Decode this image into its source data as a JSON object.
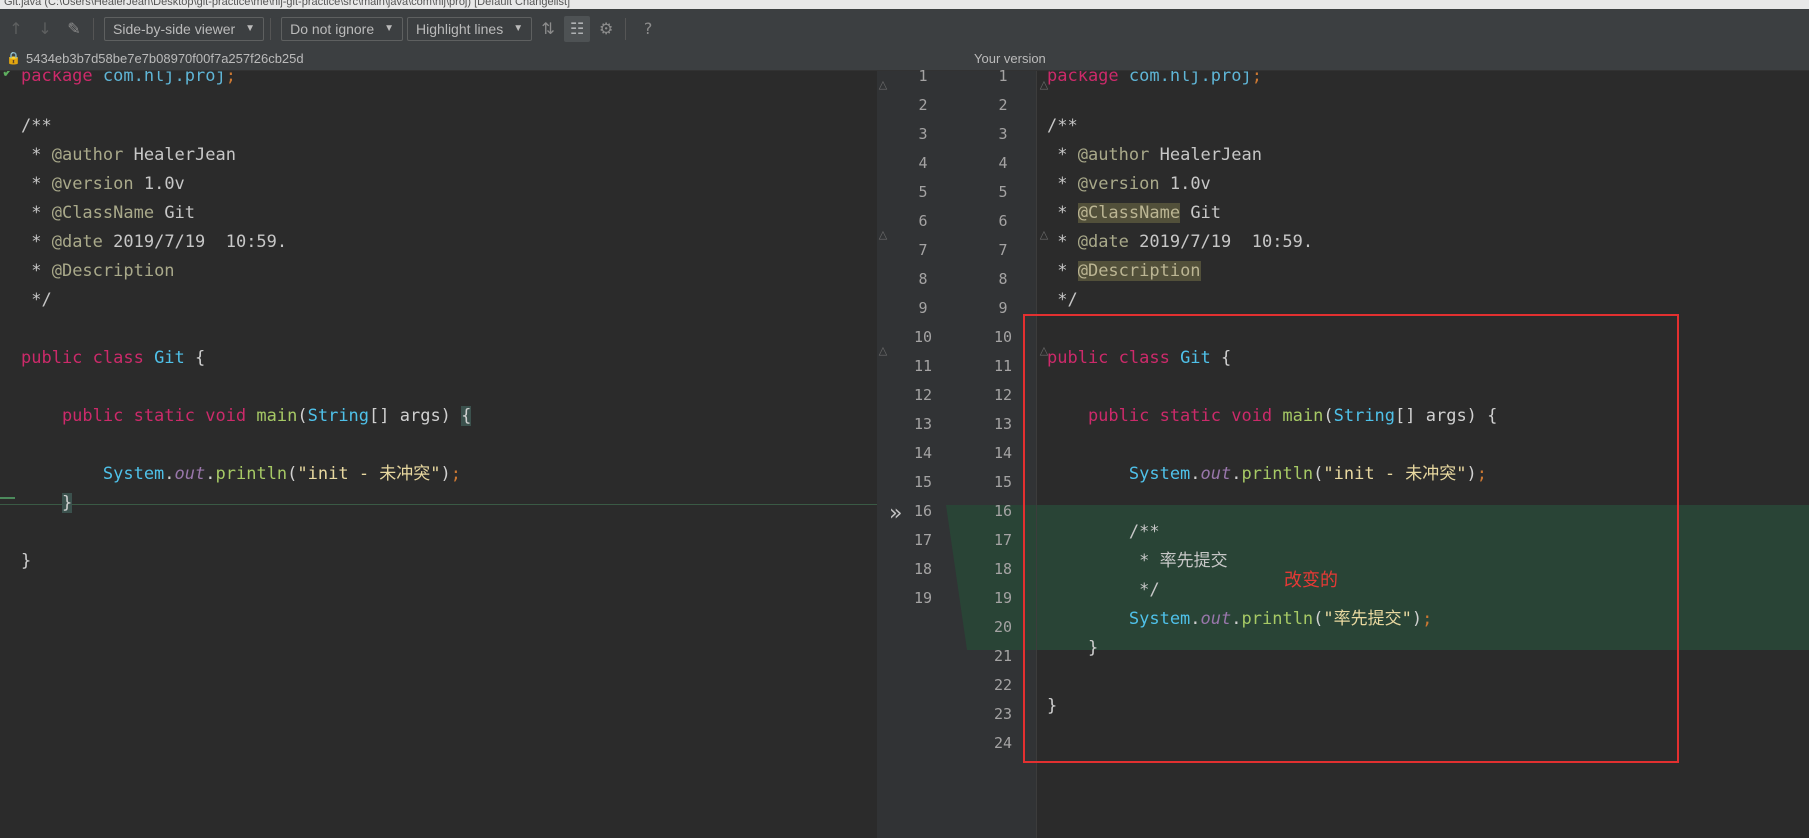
{
  "window_title": "Git.java (C:\\Users\\HealerJean\\Desktop\\git-practice\\me\\hlj-git-practice\\src\\main\\java\\com\\hlj\\proj) [Default Changelist]",
  "toolbar": {
    "viewer_mode": "Side-by-side viewer",
    "whitespace": "Do not ignore",
    "highlight": "Highlight lines",
    "help": "?"
  },
  "infobar": {
    "left_revision": "5434eb3b7d58be7e7b08970f00f7a257f26cb25d",
    "right_title": "Your version"
  },
  "left": {
    "line_numbers": [
      "1",
      "2",
      "3",
      "4",
      "5",
      "6",
      "7",
      "8",
      "9",
      "10",
      "11",
      "12",
      "13",
      "14",
      "15",
      "16",
      "17",
      "18",
      "19"
    ],
    "lines": [
      "package com.hlj.proj;",
      "",
      "/**",
      " * @author HealerJean",
      " * @version 1.0v",
      " * @ClassName Git",
      " * @date 2019/7/19  10:59.",
      " * @Description",
      " */",
      "",
      "public class Git {",
      "",
      "    public static void main(String[] args) {",
      "",
      "        System.out.println(\"init - 未冲突\");",
      "    }",
      "",
      "}",
      ""
    ]
  },
  "right": {
    "line_numbers": [
      "1",
      "2",
      "3",
      "4",
      "5",
      "6",
      "7",
      "8",
      "9",
      "10",
      "11",
      "12",
      "13",
      "14",
      "15",
      "16",
      "17",
      "18",
      "19",
      "20",
      "21",
      "22",
      "23",
      "24"
    ],
    "lines": [
      "package com.hlj.proj;",
      "",
      "/**",
      " * @author HealerJean",
      " * @version 1.0v",
      " * @ClassName Git",
      " * @date 2019/7/19  10:59.",
      " * @Description",
      " */",
      "",
      "public class Git {",
      "",
      "    public static void main(String[] args) {",
      "",
      "        System.out.println(\"init - 未冲突\");",
      "",
      "        /**",
      "         * 率先提交",
      "         */",
      "        System.out.println(\"率先提交\");",
      "    }",
      "",
      "}",
      ""
    ]
  },
  "annotation": "改变的",
  "colors": {
    "background": "#2b2b2b",
    "diff_inserted": "#294436",
    "annotation_box": "#e33030",
    "keyword": "#cc2a6a"
  },
  "icons": [
    "arrow-up-icon",
    "arrow-down-icon",
    "edit-icon",
    "collapse-icon",
    "sync-scroll-icon",
    "settings-icon",
    "lock-icon",
    "apply-change-icon",
    "fold-icon"
  ]
}
